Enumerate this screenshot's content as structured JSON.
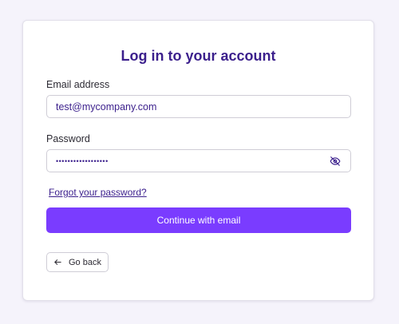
{
  "colors": {
    "page_background": "#f5f3fb",
    "title": "#3b1f8c",
    "accent": "#7a3cff",
    "link": "#3b1f8c"
  },
  "login": {
    "title": "Log in to your account",
    "email_label": "Email address",
    "email_value": "test@mycompany.com",
    "password_label": "Password",
    "password_value": "••••••••••••••••••",
    "password_toggle_icon": "eye-slash-icon",
    "forgot_link": "Forgot your password?",
    "continue_button": "Continue with email",
    "back_button": "Go back",
    "back_icon": "arrow-left-icon"
  }
}
